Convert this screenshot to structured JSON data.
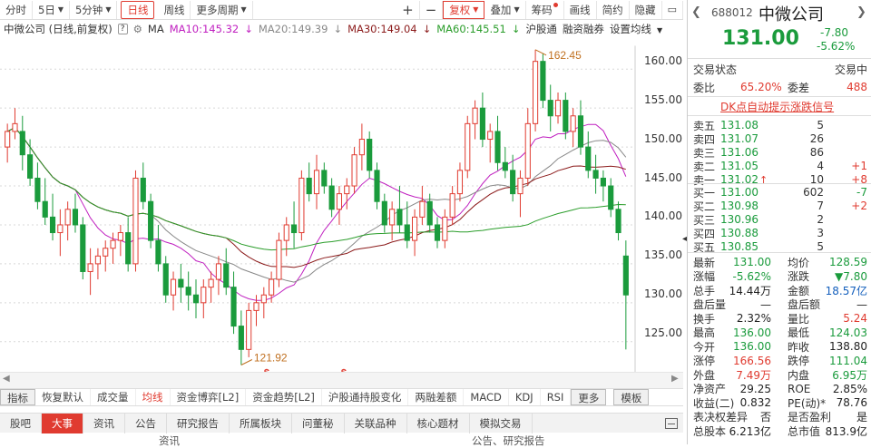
{
  "toolbar": {
    "periods": [
      "分时",
      "5日",
      "5分钟",
      "日线",
      "周线",
      "更多周期"
    ],
    "tools": [
      "复权",
      "叠加",
      "筹码",
      "画线",
      "简约",
      "隐藏"
    ]
  },
  "legend": {
    "stock": "中微公司 (日线,前复权)",
    "ma_label": "MA",
    "ma10": "MA10:145.32",
    "ma20": "MA20:149.39",
    "ma30": "MA30:149.04",
    "ma60": "MA60:145.51",
    "links": [
      "沪股通",
      "融资融券",
      "设置均线"
    ]
  },
  "chart_data": {
    "type": "candlestick",
    "ylim": [
      122,
      163
    ],
    "yticks": [
      125.0,
      130.0,
      135.0,
      140.0,
      145.0,
      150.0,
      155.0,
      160.0
    ],
    "annot_high": "162.45",
    "annot_low": "121.92",
    "markers": [
      "$",
      "$"
    ],
    "candles": [
      [
        150,
        153,
        148,
        152
      ],
      [
        152,
        155,
        151,
        153
      ],
      [
        152,
        154,
        147,
        149
      ],
      [
        149,
        151,
        145,
        146
      ],
      [
        146,
        148,
        142,
        143
      ],
      [
        143,
        146,
        140,
        141
      ],
      [
        141,
        144,
        138,
        139
      ],
      [
        139,
        142,
        136,
        140
      ],
      [
        140,
        143,
        138,
        142
      ],
      [
        142,
        144,
        139,
        140
      ],
      [
        140,
        141,
        133,
        134
      ],
      [
        134,
        137,
        131,
        135
      ],
      [
        135,
        137,
        133,
        136
      ],
      [
        136,
        138,
        134,
        137
      ],
      [
        137,
        139,
        135,
        138
      ],
      [
        138,
        140,
        136,
        139
      ],
      [
        139,
        141,
        134,
        135
      ],
      [
        135,
        147,
        134,
        146
      ],
      [
        146,
        148,
        142,
        143
      ],
      [
        143,
        144,
        137,
        138
      ],
      [
        138,
        140,
        134,
        135
      ],
      [
        135,
        136,
        130,
        131
      ],
      [
        131,
        134,
        129,
        133
      ],
      [
        133,
        135,
        130,
        132
      ],
      [
        132,
        134,
        129,
        131
      ],
      [
        131,
        133,
        128,
        130
      ],
      [
        130,
        133,
        128,
        132
      ],
      [
        132,
        134,
        130,
        133
      ],
      [
        133,
        136,
        131,
        135
      ],
      [
        135,
        137,
        131,
        132
      ],
      [
        132,
        134,
        126,
        127
      ],
      [
        127,
        129,
        122,
        124
      ],
      [
        124,
        130,
        123,
        129
      ],
      [
        129,
        131,
        127,
        130
      ],
      [
        130,
        132,
        128,
        131
      ],
      [
        131,
        134,
        130,
        133
      ],
      [
        133,
        139,
        132,
        138
      ],
      [
        138,
        141,
        136,
        140
      ],
      [
        140,
        143,
        137,
        139
      ],
      [
        139,
        147,
        138,
        146
      ],
      [
        146,
        148,
        143,
        144
      ],
      [
        144,
        149,
        142,
        147
      ],
      [
        147,
        148,
        144,
        145
      ],
      [
        145,
        146,
        141,
        142
      ],
      [
        142,
        145,
        140,
        144
      ],
      [
        144,
        146,
        142,
        145
      ],
      [
        145,
        150,
        144,
        149
      ],
      [
        149,
        153,
        147,
        151
      ],
      [
        151,
        152,
        146,
        147
      ],
      [
        147,
        148,
        142,
        143
      ],
      [
        143,
        144,
        139,
        140
      ],
      [
        140,
        143,
        138,
        142
      ],
      [
        142,
        145,
        139,
        140
      ],
      [
        140,
        143,
        137,
        138
      ],
      [
        138,
        142,
        136,
        141
      ],
      [
        141,
        145,
        140,
        143
      ],
      [
        143,
        144,
        139,
        140
      ],
      [
        140,
        141,
        137,
        138
      ],
      [
        138,
        142,
        137,
        141
      ],
      [
        141,
        145,
        140,
        144
      ],
      [
        144,
        148,
        143,
        147
      ],
      [
        147,
        154,
        146,
        153
      ],
      [
        153,
        156,
        151,
        155
      ],
      [
        155,
        157,
        150,
        151
      ],
      [
        151,
        153,
        148,
        152
      ],
      [
        152,
        154,
        147,
        148
      ],
      [
        148,
        150,
        146,
        147
      ],
      [
        147,
        149,
        143,
        144
      ],
      [
        144,
        147,
        141,
        146
      ],
      [
        146,
        155,
        145,
        153
      ],
      [
        153,
        162.5,
        152,
        161
      ],
      [
        161,
        162,
        155,
        156
      ],
      [
        156,
        158,
        152,
        154
      ],
      [
        154,
        157,
        153,
        156
      ],
      [
        156,
        157,
        151,
        152
      ],
      [
        152,
        155,
        150,
        154
      ],
      [
        154,
        156,
        149,
        150
      ],
      [
        150,
        152,
        146,
        147
      ],
      [
        147,
        149,
        144,
        146
      ],
      [
        146,
        147,
        143,
        145
      ],
      [
        145,
        146,
        141,
        142
      ],
      [
        142,
        143,
        138,
        139
      ],
      [
        136,
        138,
        124,
        131
      ]
    ]
  },
  "indicators": [
    "指标",
    "恢复默认",
    "成交量",
    "均线",
    "资金博弈[L2]",
    "资金趋势[L2]",
    "沪股通持股变化",
    "两融差额",
    "MACD",
    "KDJ",
    "RSI",
    "更多",
    "模板"
  ],
  "news_tabs": [
    "股吧",
    "大事",
    "资讯",
    "公告",
    "研究报告",
    "所属板块",
    "问董秘",
    "关联品种",
    "核心题材",
    "模拟交易"
  ],
  "news_sub": [
    "资讯",
    "公告、研究报告"
  ],
  "quote": {
    "code": "688012",
    "name": "中微公司",
    "price": "131.00",
    "change": "-7.80",
    "change_pct": "-5.62%",
    "status_label": "交易状态",
    "status_value": "交易中",
    "weibi_label": "委比",
    "weibi_value": "65.20%",
    "weicha_label": "委差",
    "weicha_value": "488",
    "dk_link": "DK点自动提示涨跌信号",
    "asks": [
      {
        "label": "卖五",
        "price": "131.08",
        "vol": "5",
        "chg": ""
      },
      {
        "label": "卖四",
        "price": "131.07",
        "vol": "26",
        "chg": ""
      },
      {
        "label": "卖三",
        "price": "131.06",
        "vol": "86",
        "chg": ""
      },
      {
        "label": "卖二",
        "price": "131.05",
        "vol": "4",
        "chg": "+1"
      },
      {
        "label": "卖一",
        "price": "131.02",
        "vol": "10",
        "chg": "+8"
      }
    ],
    "bids": [
      {
        "label": "买一",
        "price": "131.00",
        "vol": "602",
        "chg": "-7"
      },
      {
        "label": "买二",
        "price": "130.98",
        "vol": "7",
        "chg": "+2"
      },
      {
        "label": "买三",
        "price": "130.96",
        "vol": "2",
        "chg": ""
      },
      {
        "label": "买四",
        "price": "130.88",
        "vol": "3",
        "chg": ""
      },
      {
        "label": "买五",
        "price": "130.85",
        "vol": "5",
        "chg": ""
      }
    ],
    "stats": [
      {
        "l1": "最新",
        "v1": "131.00",
        "c1": "grn",
        "l2": "均价",
        "v2": "128.59",
        "c2": "grn"
      },
      {
        "l1": "涨幅",
        "v1": "-5.62%",
        "c1": "grn",
        "l2": "涨跌",
        "v2": "▼7.80",
        "c2": "grn"
      },
      {
        "l1": "总手",
        "v1": "14.44万",
        "c1": "",
        "l2": "金额",
        "v2": "18.57亿",
        "c2": "blu"
      },
      {
        "l1": "盘后量",
        "v1": "—",
        "c1": "",
        "l2": "盘后额",
        "v2": "—",
        "c2": ""
      },
      {
        "l1": "换手",
        "v1": "2.32%",
        "c1": "",
        "l2": "量比",
        "v2": "5.24",
        "c2": "red"
      },
      {
        "l1": "最高",
        "v1": "136.00",
        "c1": "grn",
        "l2": "最低",
        "v2": "124.03",
        "c2": "grn"
      },
      {
        "l1": "今开",
        "v1": "136.00",
        "c1": "grn",
        "l2": "昨收",
        "v2": "138.80",
        "c2": ""
      },
      {
        "l1": "涨停",
        "v1": "166.56",
        "c1": "red",
        "l2": "跌停",
        "v2": "111.04",
        "c2": "grn"
      },
      {
        "l1": "外盘",
        "v1": "7.49万",
        "c1": "red",
        "l2": "内盘",
        "v2": "6.95万",
        "c2": "grn"
      },
      {
        "l1": "净资产",
        "v1": "29.25",
        "c1": "",
        "l2": "ROE",
        "v2": "2.85%",
        "c2": ""
      },
      {
        "l1": "收益(二)",
        "v1": "0.832",
        "c1": "",
        "l2": "PE(动)*",
        "v2": "78.76",
        "c2": ""
      },
      {
        "l1": "表决权差异",
        "v1": "否",
        "c1": "",
        "l2": "是否盈利",
        "v2": "是",
        "c2": ""
      },
      {
        "l1": "总股本",
        "v1": "6.213亿",
        "c1": "",
        "l2": "总市值",
        "v2": "813.9亿",
        "c2": ""
      }
    ]
  },
  "colors": {
    "up": "#e03b30",
    "down": "#1a9b3c",
    "ma10": "#c020c0",
    "ma20": "#888888",
    "ma30": "#8b1a1a",
    "ma60": "#2a9d2a",
    "blue": "#1560bd"
  }
}
